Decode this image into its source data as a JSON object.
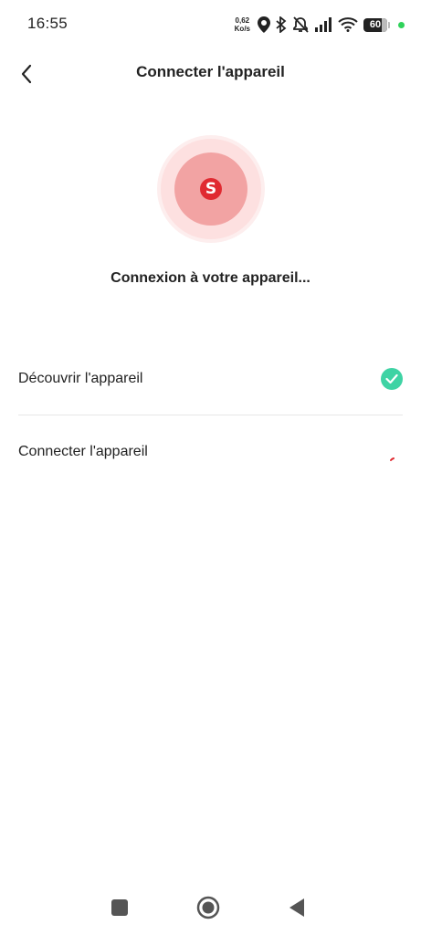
{
  "status_bar": {
    "time": "16:55",
    "net_speed_value": "0,62",
    "net_speed_unit": "Ko/s",
    "battery_level": "60",
    "icons": [
      "location-icon",
      "bluetooth-icon",
      "mute-icon",
      "signal-icon",
      "wifi-icon",
      "battery-icon"
    ]
  },
  "header": {
    "back_icon": "chevron-left-icon",
    "title": "Connecter l'appareil"
  },
  "device": {
    "logo_letter": "S",
    "brand_color": "#e02a31"
  },
  "status_message": "Connexion à votre appareil...",
  "steps": [
    {
      "label": "Découvrir l'appareil",
      "state": "done",
      "icon": "check-circle-icon",
      "color": "#3ed3a4"
    },
    {
      "label": "Connecter l'appareil",
      "state": "in-progress",
      "icon": "spinner-icon",
      "color": "#e02a31"
    }
  ],
  "system_nav": {
    "icons": [
      "recents-square-icon",
      "home-circle-icon",
      "back-triangle-icon"
    ]
  }
}
